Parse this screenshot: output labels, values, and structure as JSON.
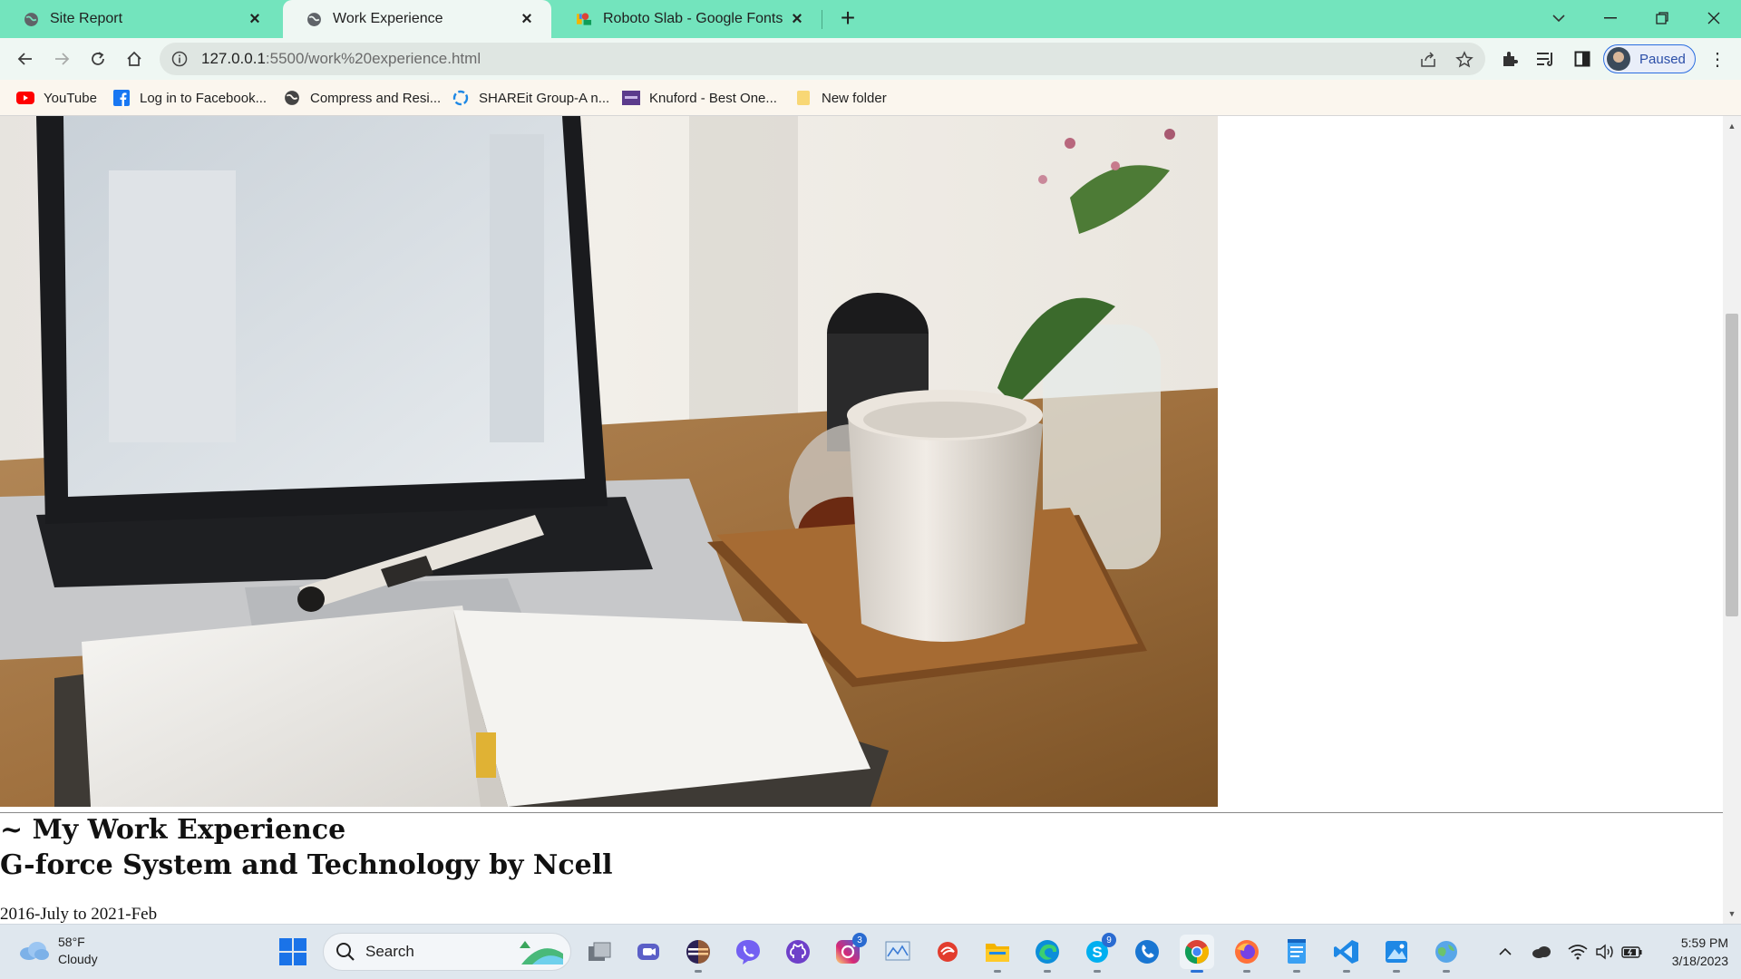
{
  "browser": {
    "tabs": [
      {
        "title": "Site Report",
        "favicon": "globe-icon",
        "active": false
      },
      {
        "title": "Work Experience",
        "favicon": "globe-icon",
        "active": true
      },
      {
        "title": "Roboto Slab - Google Fonts",
        "favicon": "google-fonts-icon",
        "active": false
      }
    ],
    "url_host": "127.0.0.1",
    "url_rest": ":5500/work%20experience.html",
    "profile_label": "Paused",
    "accent_color": "#73e4bd"
  },
  "bookmarks": [
    {
      "label": "YouTube",
      "icon": "youtube-icon"
    },
    {
      "label": "Log in to Facebook...",
      "icon": "facebook-icon"
    },
    {
      "label": "Compress and Resi...",
      "icon": "globe-icon"
    },
    {
      "label": "SHAREit Group-A n...",
      "icon": "shareit-icon"
    },
    {
      "label": "Knuford - Best One...",
      "icon": "knuford-icon"
    },
    {
      "label": "New folder",
      "icon": "folder-icon"
    }
  ],
  "page": {
    "hero_image": "laptop-notebook-coffee-photo",
    "heading": "~ My Work Experience",
    "company": "G-force System and Technology by Ncell",
    "period": "2016-July to 2021-Feb"
  },
  "taskbar": {
    "weather_temp": "58°F",
    "weather_desc": "Cloudy",
    "search_label": "Search",
    "time": "5:59 PM",
    "date": "3/18/2023",
    "badges": {
      "instagram": "3",
      "skype": "9"
    }
  }
}
